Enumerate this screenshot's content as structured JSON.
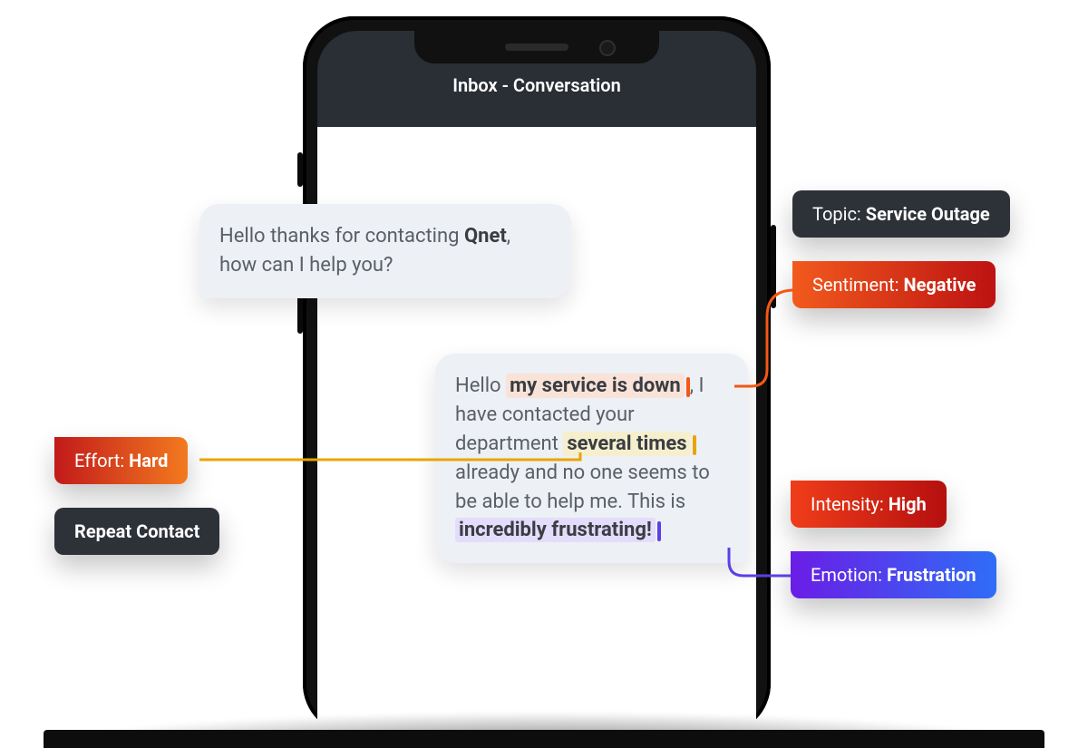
{
  "header": {
    "title": "Inbox - Conversation"
  },
  "messages": {
    "agent": {
      "pre": "Hello thanks for contacting ",
      "bold": "Qnet",
      "post": ", how can I help you?"
    },
    "user": {
      "t1": "Hello ",
      "hl1": "my service is down",
      "t2": ", I have contacted your department ",
      "hl2": "several times",
      "t3": " already and no one seems to be able to help me. This is ",
      "hl3": "incredibly frustrating!"
    }
  },
  "tags": {
    "topic": {
      "label": "Topic: ",
      "value": "Service Outage"
    },
    "sentiment": {
      "label": "Sentiment: ",
      "value": "Negative"
    },
    "intensity": {
      "label": "Intensity: ",
      "value": "High"
    },
    "emotion": {
      "label": "Emotion: ",
      "value": "Frustration"
    },
    "effort": {
      "label": "Effort: ",
      "value": "Hard"
    },
    "repeat": {
      "label": "Repeat Contact"
    }
  },
  "colors": {
    "dark": "#2d3138",
    "orange_grad": [
      "#c21a1a",
      "#f37a1f"
    ],
    "red_grad": [
      "#f25a1d",
      "#bd1212"
    ],
    "purple_grad": [
      "#6a1de6",
      "#2f6df6"
    ],
    "connector_orange": "#f35815",
    "connector_yellow": "#e9a400",
    "connector_purple": "#5d3fe6"
  }
}
